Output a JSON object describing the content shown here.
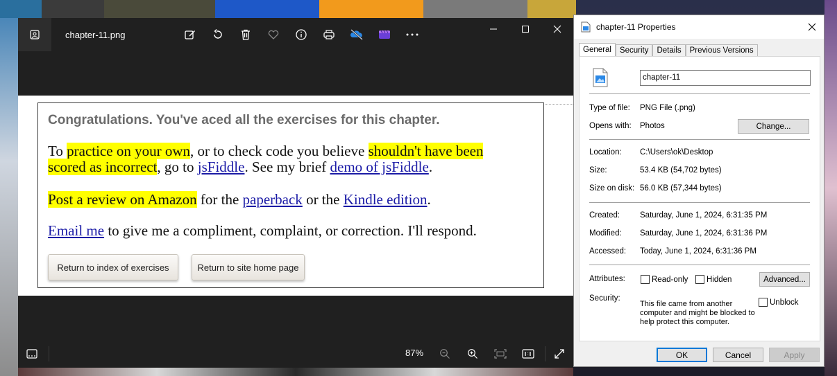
{
  "viewer": {
    "filename": "chapter-11.png",
    "zoom": "87%",
    "toolbar_icons": [
      "edit-icon",
      "rotate-icon",
      "delete-icon",
      "favorite-icon",
      "info-icon",
      "print-icon",
      "onedrive-icon",
      "clipchamp-icon",
      "more-icon"
    ]
  },
  "page": {
    "congrats": "Congratulations. You've aced all the exercises for this chapter.",
    "p1": {
      "a": "To ",
      "b": "practice on your own",
      "c": ", or to check code you believe ",
      "d": "shouldn't have been",
      "e": "scored as incorrect",
      "f": ", go to ",
      "g": "jsFiddle",
      "h": ". See my brief ",
      "i": "demo of jsFiddle",
      "j": "."
    },
    "p2": {
      "a": "Post a review on Amazon",
      "b": " for the ",
      "c": "paperback",
      "d": " or the ",
      "e": "Kindle edition",
      "f": "."
    },
    "p3": {
      "a": "Email me",
      "b": " to give me a compliment, complaint, or correction. I'll respond."
    },
    "buttons": {
      "index": "Return to index of exercises",
      "home": "Return to site home page"
    },
    "highlight_color": "#ffff00",
    "link_color": "#1a1aa6"
  },
  "props": {
    "title": "chapter-11 Properties",
    "tabs": [
      "General",
      "Security",
      "Details",
      "Previous Versions"
    ],
    "name": "chapter-11",
    "type_label": "Type of file:",
    "type_value": "PNG File (.png)",
    "opens_label": "Opens with:",
    "opens_value": "Photos",
    "change": "Change...",
    "location_label": "Location:",
    "location_value": "C:\\Users\\ok\\Desktop",
    "size_label": "Size:",
    "size_value": "53.4 KB (54,702 bytes)",
    "disk_label": "Size on disk:",
    "disk_value": "56.0 KB (57,344 bytes)",
    "created_label": "Created:",
    "created_value": "Saturday, June 1, 2024, 6:31:35 PM",
    "modified_label": "Modified:",
    "modified_value": "Saturday, June 1, 2024, 6:31:36 PM",
    "accessed_label": "Accessed:",
    "accessed_value": "Today, June 1, 2024, 6:31:36 PM",
    "attributes_label": "Attributes:",
    "readonly": "Read-only",
    "hidden": "Hidden",
    "advanced": "Advanced...",
    "security_label": "Security:",
    "security_msg": "This file came from another computer and might be blocked to help protect this computer.",
    "unblock": "Unblock",
    "ok": "OK",
    "cancel": "Cancel",
    "apply": "Apply"
  }
}
